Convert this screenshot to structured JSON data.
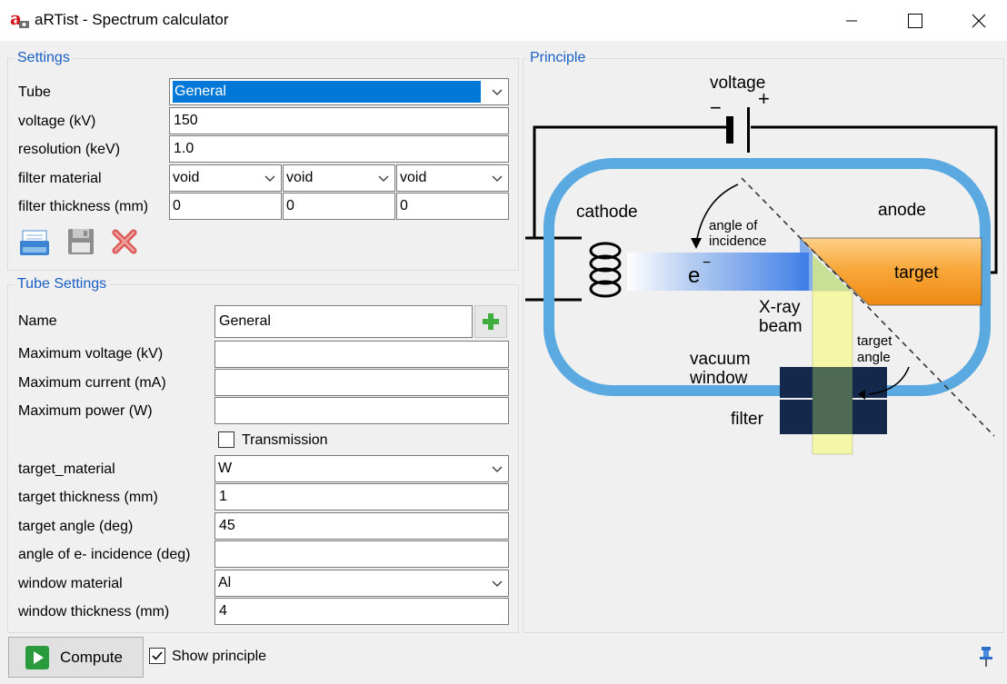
{
  "window": {
    "title": "aRTist - Spectrum calculator"
  },
  "settings": {
    "group_title": "Settings",
    "tube_label": "Tube",
    "tube_value": "General",
    "voltage_label": "voltage (kV)",
    "voltage_value": "150",
    "resolution_label": "resolution (keV)",
    "resolution_value": "1.0",
    "filter_material_label": "filter material",
    "filter_materials": [
      "void",
      "void",
      "void"
    ],
    "filter_thickness_label": "filter thickness (mm)",
    "filter_thicknesses": [
      "0",
      "0",
      "0"
    ]
  },
  "tube_settings": {
    "group_title": "Tube Settings",
    "name_label": "Name",
    "name_value": "General",
    "max_voltage_label": "Maximum voltage (kV)",
    "max_voltage_value": "",
    "max_current_label": "Maximum current (mA)",
    "max_current_value": "",
    "max_power_label": "Maximum power (W)",
    "max_power_value": "",
    "transmission_label": "Transmission",
    "transmission_checked": false,
    "target_material_label": "target_material",
    "target_material_value": "W",
    "target_thickness_label": "target thickness (mm)",
    "target_thickness_value": "1",
    "target_angle_label": "target angle (deg)",
    "target_angle_value": "45",
    "incidence_label": "angle of e- incidence (deg)",
    "incidence_value": "",
    "window_material_label": "window material",
    "window_material_value": "Al",
    "window_thickness_label": "window thickness (mm)",
    "window_thickness_value": "4"
  },
  "principle": {
    "group_title": "Principle",
    "voltage": "voltage",
    "minus": "−",
    "plus": "+",
    "cathode": "cathode",
    "anode": "anode",
    "angle_of": "angle of",
    "incidence": "incidence",
    "electron": "e",
    "electron_sup": "−",
    "target": "target",
    "xray": "X-ray",
    "beam": "beam",
    "target_angle_1": "target",
    "target_angle_2": "angle",
    "vacuum": "vacuum",
    "window": "window",
    "filter": "filter"
  },
  "footer": {
    "compute_label": "Compute",
    "show_principle_label": "Show principle",
    "show_principle_checked": true
  },
  "colors": {
    "accent_blue": "#0078d7",
    "group_title": "#1a5fc4",
    "vacuum_tube": "#5aa9e0",
    "target_orange": "#f79a1c",
    "beam_yellow": "#f4f7a6",
    "filter_navy": "#13284a",
    "compute_green": "#2a9a3c"
  },
  "icons": {
    "app": "artist-logo-icon",
    "open": "open-folder-icon",
    "save": "save-disk-icon",
    "delete": "delete-x-icon",
    "add": "plus-icon",
    "pin": "pin-icon",
    "compute": "play-icon"
  }
}
